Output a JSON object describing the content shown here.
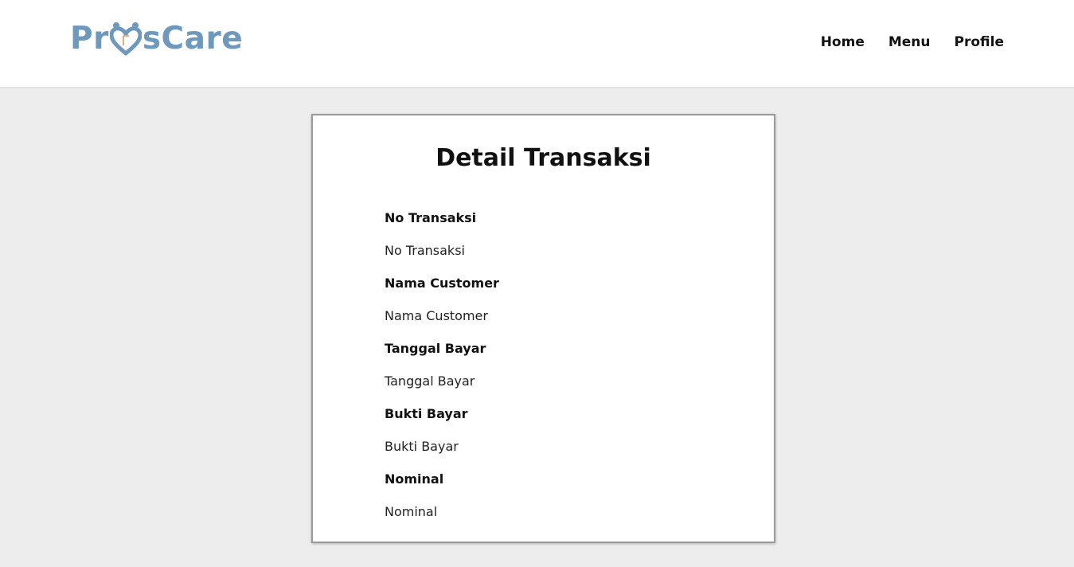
{
  "header": {
    "logo_text_before": "Pr",
    "logo_text_after": "sCare",
    "nav": [
      "Home",
      "Menu",
      "Profile"
    ]
  },
  "card": {
    "title": "Detail Transaksi",
    "fields": [
      {
        "label": "No Transaksi",
        "value": "No Transaksi"
      },
      {
        "label": "Nama Customer",
        "value": "Nama Customer"
      },
      {
        "label": "Tanggal Bayar",
        "value": "Tanggal Bayar"
      },
      {
        "label": "Bukti Bayar",
        "value": "Bukti Bayar"
      },
      {
        "label": "Nominal",
        "value": "Nominal"
      }
    ]
  },
  "colors": {
    "brand": "#6f98bd",
    "accent": "#e8a87c",
    "background": "#ededed"
  }
}
